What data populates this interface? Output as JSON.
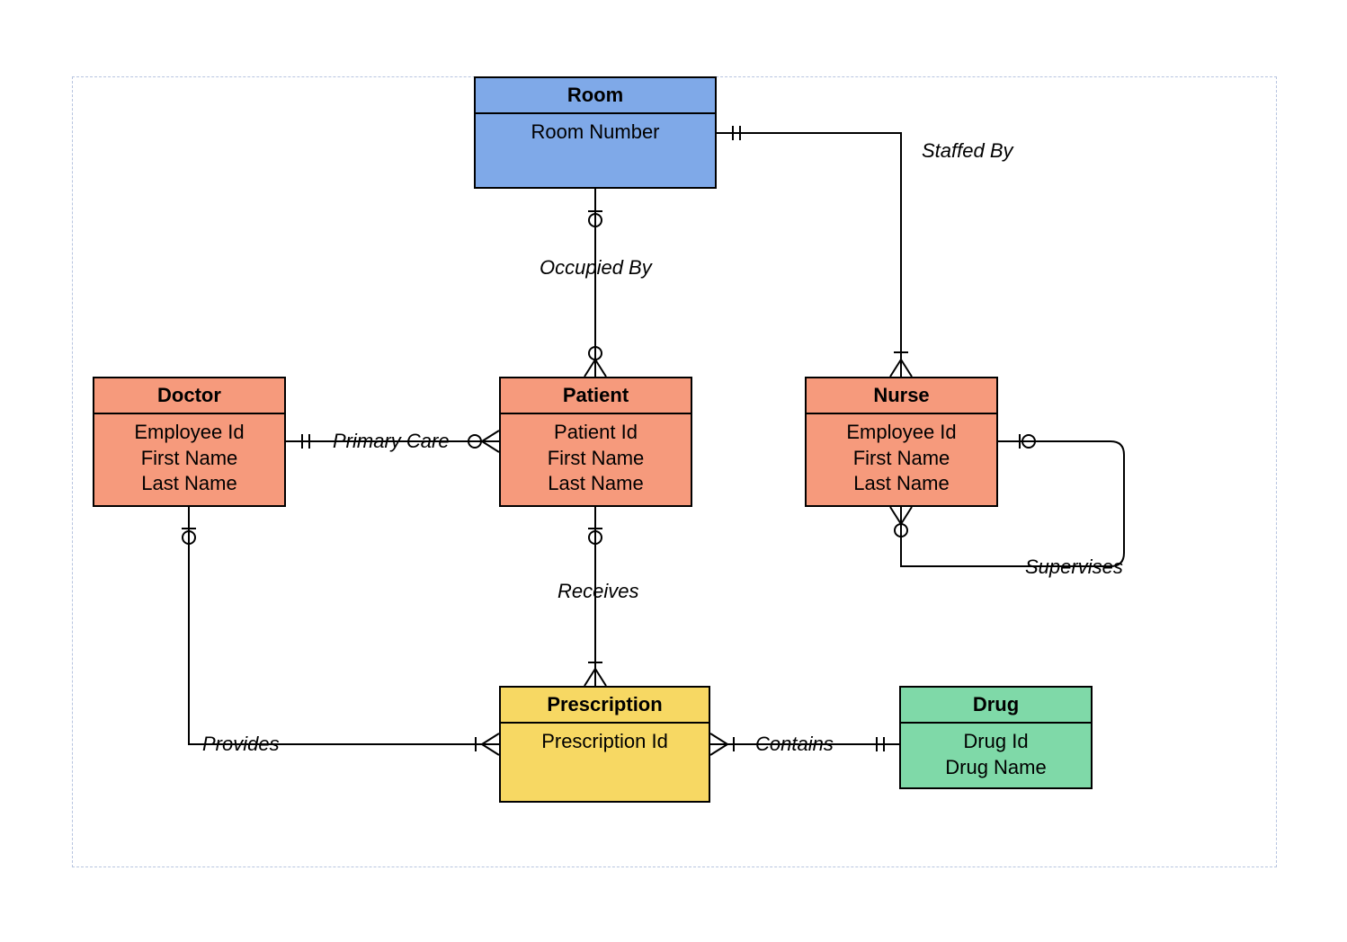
{
  "entities": {
    "room": {
      "title": "Room",
      "attrs": [
        "Room Number"
      ]
    },
    "doctor": {
      "title": "Doctor",
      "attrs": [
        "Employee Id",
        "First Name",
        "Last Name"
      ]
    },
    "patient": {
      "title": "Patient",
      "attrs": [
        "Patient Id",
        "First Name",
        "Last Name"
      ]
    },
    "nurse": {
      "title": "Nurse",
      "attrs": [
        "Employee Id",
        "First Name",
        "Last Name"
      ]
    },
    "prescription": {
      "title": "Prescription",
      "attrs": [
        "Prescription Id"
      ]
    },
    "drug": {
      "title": "Drug",
      "attrs": [
        "Drug Id",
        "Drug Name"
      ]
    }
  },
  "relationships": {
    "occupiedBy": "Occupied By",
    "staffedBy": "Staffed By",
    "primaryCare": "Primary Care",
    "receives": "Receives",
    "provides": "Provides",
    "contains": "Contains",
    "supervises": "Supervises"
  }
}
